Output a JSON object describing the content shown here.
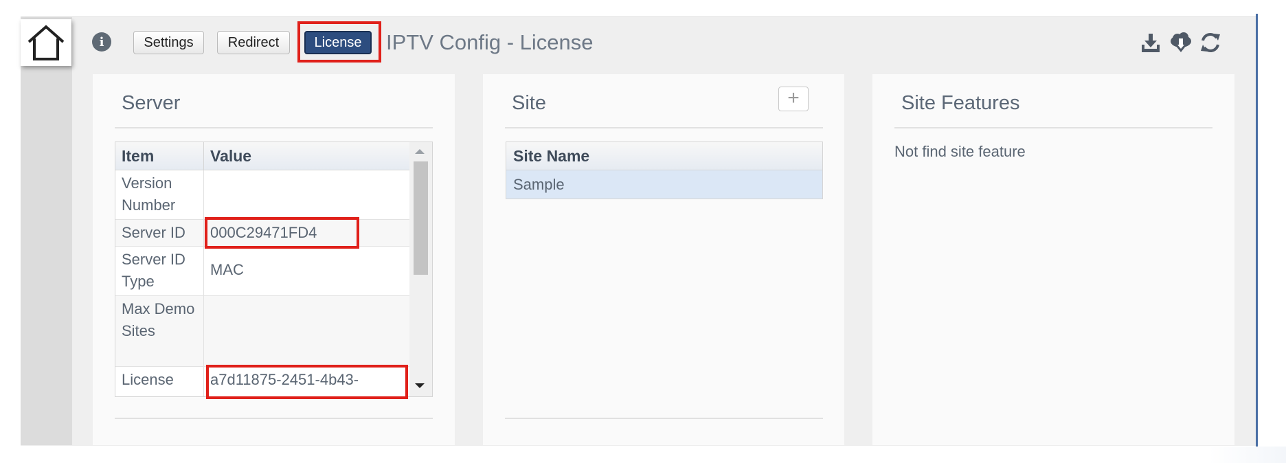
{
  "toolbar": {
    "settings_label": "Settings",
    "redirect_label": "Redirect",
    "license_label": "License",
    "info_glyph": "i",
    "icons": [
      "home-icon",
      "info-icon",
      "download-tray-icon",
      "cloud-download-icon",
      "refresh-icon"
    ]
  },
  "page_title": "IPTV Config - License",
  "server_panel": {
    "title": "Server",
    "columns": [
      "Item",
      "Value"
    ],
    "rows": [
      {
        "item": "Version Number",
        "value": ""
      },
      {
        "item": "Server ID",
        "value": "000C29471FD4"
      },
      {
        "item": "Server ID Type",
        "value": "MAC"
      },
      {
        "item": "Max Demo Sites",
        "value": ""
      },
      {
        "item": "License",
        "value": "a7d11875-2451-4b43-"
      }
    ]
  },
  "site_panel": {
    "title": "Site",
    "add_glyph": "+",
    "columns": [
      "Site Name"
    ],
    "rows": [
      "Sample"
    ]
  },
  "features_panel": {
    "title": "Site Features",
    "empty_message": "Not find site feature"
  },
  "colors": {
    "highlight": "#e0201a",
    "active_tab": "#2d4d7f",
    "selected_row": "#dbe7f6",
    "accent_rule": "#4a6fa5"
  }
}
